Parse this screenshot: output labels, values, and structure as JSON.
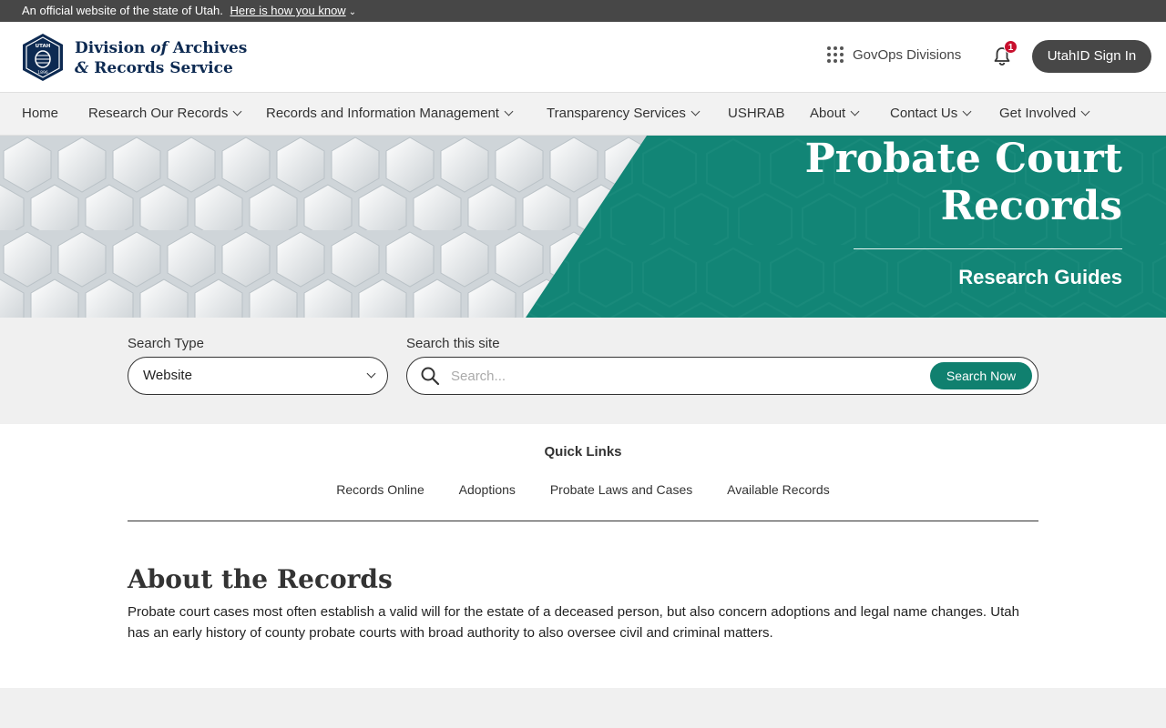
{
  "official_bar": {
    "text": "An official website of the state of Utah.",
    "how_link": "Here is how you know"
  },
  "header": {
    "logo_seal_text": "UTAH",
    "logo_seal_year": "1896",
    "logo_line1_a": "Division ",
    "logo_line1_b": "of",
    "logo_line1_c": " Archives",
    "logo_line2_a": "&",
    "logo_line2_b": " Records Service",
    "govops_label": "GovOps Divisions",
    "notification_count": "1",
    "signin_label": "UtahID Sign In"
  },
  "nav": {
    "items": [
      {
        "label": "Home"
      },
      {
        "label": "Research Our Records"
      },
      {
        "label": "Records and Information Management"
      },
      {
        "label": "Transparency Services"
      },
      {
        "label": "USHRAB"
      },
      {
        "label": "About"
      },
      {
        "label": "Contact Us"
      },
      {
        "label": "Get Involved"
      }
    ]
  },
  "hero": {
    "title_line1": "Probate Court",
    "title_line2": "Records",
    "subtitle": "Research Guides"
  },
  "search": {
    "type_label": "Search Type",
    "type_value": "Website",
    "site_label": "Search this site",
    "placeholder": "Search...",
    "button_label": "Search Now"
  },
  "quick_links": {
    "title": "Quick Links",
    "links": [
      {
        "label": "Records Online"
      },
      {
        "label": "Adoptions"
      },
      {
        "label": "Probate Laws and Cases"
      },
      {
        "label": "Available Records"
      }
    ]
  },
  "about": {
    "title": "About the Records",
    "body": "Probate court cases most often establish a valid will for the estate of a deceased person, but also concern adoptions and legal name changes. Utah has an early history of county probate courts with broad authority to also oversee civil and criminal matters."
  },
  "colors": {
    "teal": "#10806f",
    "navy": "#0d2a52",
    "dark_gray": "#474747",
    "badge_red": "#c8102e"
  }
}
